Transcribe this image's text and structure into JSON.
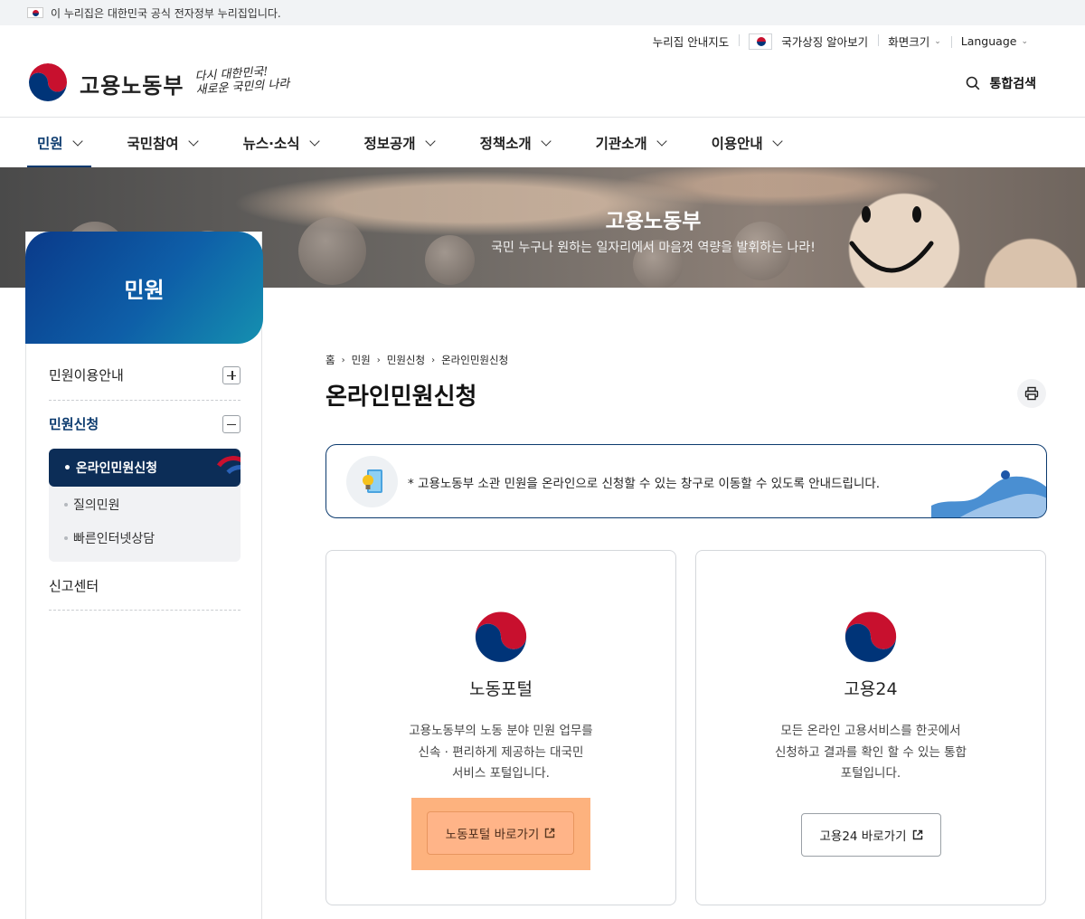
{
  "gov_banner": {
    "text": "이 누리집은 대한민국 공식 전자정부 누리집입니다."
  },
  "util_links": {
    "sitemap": "누리집 안내지도",
    "symbol": "국가상징 알아보기",
    "screen_size": "화면크기",
    "language": "Language"
  },
  "header": {
    "logo_text": "고용노동부",
    "slogan_line1": "다시 대한민국!",
    "slogan_line2": "새로운 국민의 나라",
    "search_label": "통합검색"
  },
  "gnb": [
    "민원",
    "국민참여",
    "뉴스·소식",
    "정보공개",
    "정책소개",
    "기관소개",
    "이용안내"
  ],
  "hero": {
    "title": "고용노동부",
    "subtitle": "국민 누구나 원하는 일자리에서 마음껏 역량을 발휘하는 나라!"
  },
  "side": {
    "title": "민원",
    "items": [
      "민원이용안내",
      "민원신청",
      "신고센터"
    ],
    "sub_items": [
      "• 온라인민원신청",
      "질의민원",
      "빠른인터넷상담"
    ]
  },
  "breadcrumb": [
    "홈",
    "민원",
    "민원신청",
    "온라인민원신청"
  ],
  "page_title": "온라인민원신청",
  "notice": {
    "text": "* 고용노동부 소관 민원을 온라인으로 신청할 수 있는 창구로 이동할 수 있도록 안내드립니다."
  },
  "cards": [
    {
      "title": "노동포털",
      "desc": [
        "고용노동부의 노동 분야 민원 업무를",
        "신속 · 편리하게 제공하는 대국민",
        "서비스 포털입니다."
      ],
      "button": "노동포털 바로가기"
    },
    {
      "title": "고용24",
      "desc": [
        "모든 온라인 고용서비스를 한곳에서",
        "신청하고 결과를 확인 할 수 있는 통합",
        "포털입니다."
      ],
      "button": "고용24 바로가기"
    }
  ],
  "colors": {
    "primary": "#0b3a6e",
    "highlight": "#fdb27e",
    "emblem_red": "#c8102e",
    "emblem_blue": "#003478"
  }
}
